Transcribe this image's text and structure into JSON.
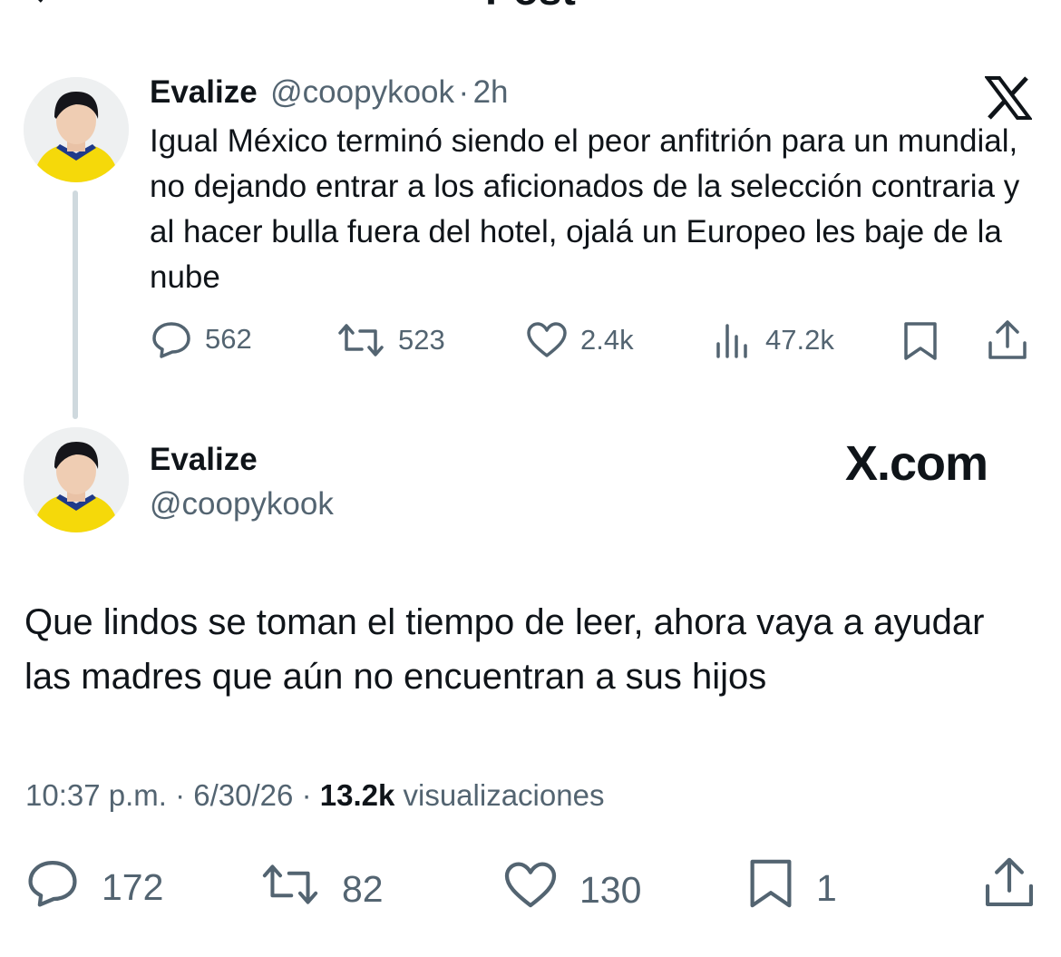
{
  "header": {
    "title": "Post"
  },
  "quoted_tweet": {
    "name": "Evalize",
    "handle": "@coopykook",
    "separator": "·",
    "time": "2h",
    "text": "Igual México terminó siendo el peor anfitrión para un mundial, no dejando entrar a los aficionados de la selección contraria y al hacer bulla fuera del hotel, ojalá un Europeo les baje de la nube",
    "actions": {
      "replies": "562",
      "reposts": "523",
      "likes": "2.4k",
      "views": "47.2k"
    }
  },
  "main_tweet": {
    "name": "Evalize",
    "handle": "@coopykook",
    "watermark": "X.com",
    "text": "Que lindos se toman el tiempo de leer, ahora vaya a ayudar las madres que aún no encuentran a sus hijos",
    "time": "10:37 p.m.",
    "date": "6/30/26",
    "sep": "·",
    "views_count": "13.2k",
    "views_label": "visualizaciones",
    "actions": {
      "replies": "172",
      "reposts": "82",
      "likes": "130",
      "bookmarks": "1"
    }
  },
  "icons": [
    "back-arrow-icon",
    "x-logo-icon",
    "reply-icon",
    "repost-icon",
    "like-icon",
    "views-icon",
    "bookmark-icon",
    "share-icon"
  ],
  "colors": {
    "text": "#0f1419",
    "muted": "#536471",
    "line": "#cfd9de",
    "jersey": "#f5d90a"
  }
}
